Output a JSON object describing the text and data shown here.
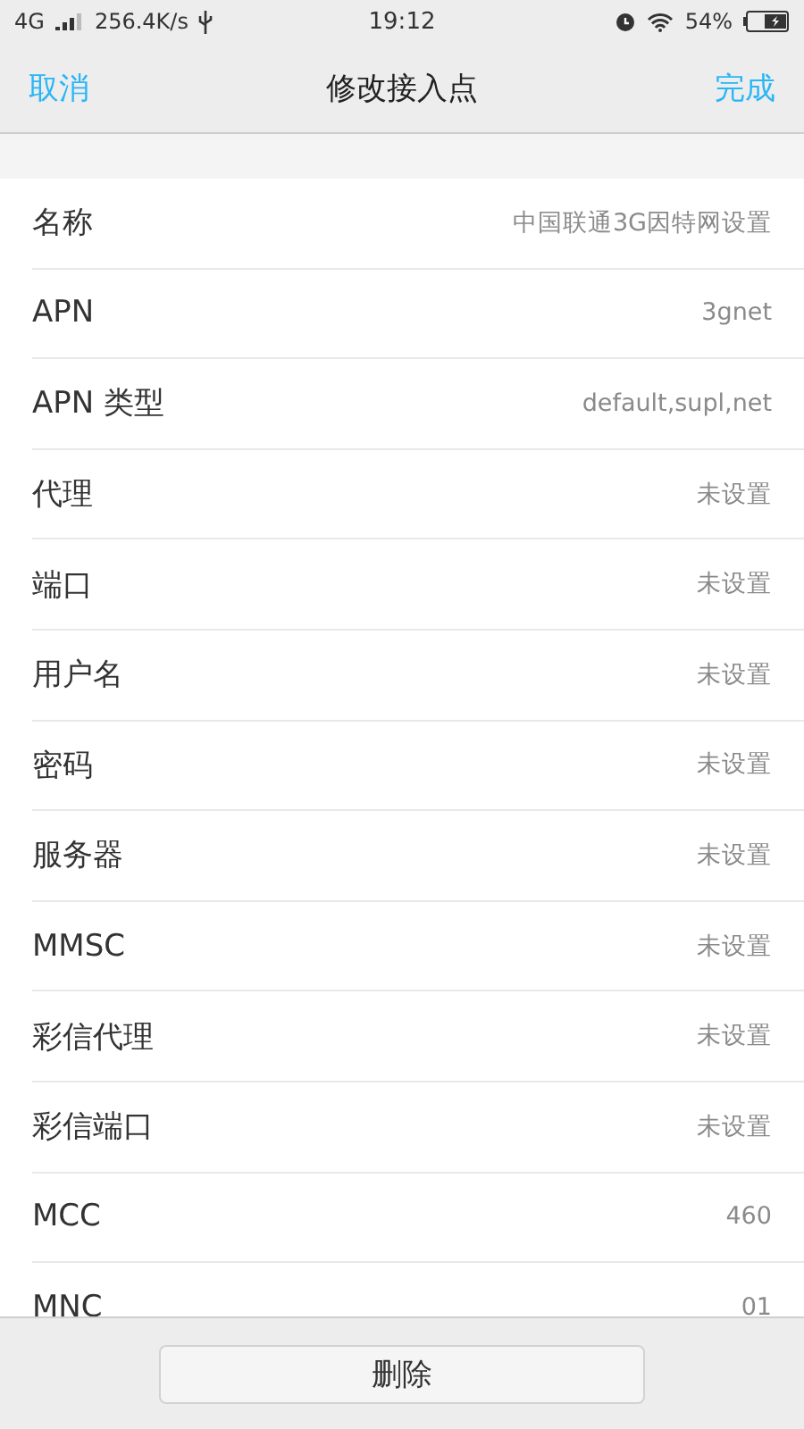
{
  "status_bar": {
    "network": "4G",
    "speed": "256.4K/s",
    "time": "19:12",
    "battery": "54%"
  },
  "header": {
    "cancel": "取消",
    "title": "修改接入点",
    "done": "完成"
  },
  "rows": [
    {
      "label": "名称",
      "value": "中国联通3G因特网设置"
    },
    {
      "label": "APN",
      "value": "3gnet"
    },
    {
      "label": "APN 类型",
      "value": "default,supl,net"
    },
    {
      "label": "代理",
      "value": "未设置"
    },
    {
      "label": "端口",
      "value": "未设置"
    },
    {
      "label": "用户名",
      "value": "未设置"
    },
    {
      "label": "密码",
      "value": "未设置"
    },
    {
      "label": "服务器",
      "value": "未设置"
    },
    {
      "label": "MMSC",
      "value": "未设置"
    },
    {
      "label": "彩信代理",
      "value": "未设置"
    },
    {
      "label": "彩信端口",
      "value": "未设置"
    },
    {
      "label": "MCC",
      "value": "460"
    },
    {
      "label": "MNC",
      "value": "01"
    }
  ],
  "delete_button": "删除"
}
